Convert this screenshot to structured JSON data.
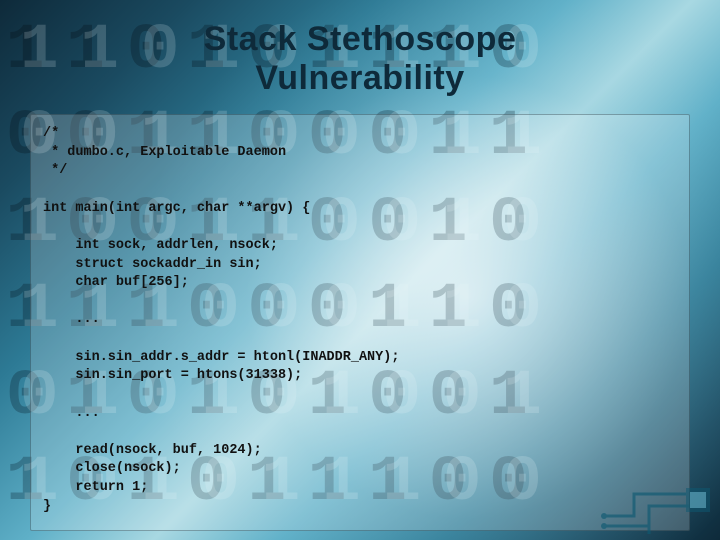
{
  "title_line1": "Stack Stethoscope",
  "title_line2": "Vulnerability",
  "code_lines": [
    "/*",
    " * dumbo.c, Exploitable Daemon",
    " */",
    "",
    "int main(int argc, char **argv) {",
    "",
    "    int sock, addrlen, nsock;",
    "    struct sockaddr_in sin;",
    "    char buf[256];",
    "",
    "    ...",
    "",
    "    sin.sin_addr.s_addr = htonl(INADDR_ANY);",
    "    sin.sin_port = htons(31338);",
    "",
    "    ...",
    "",
    "    read(nsock, buf, 1024);",
    "    close(nsock);",
    "    return 1;",
    "}"
  ],
  "bg_digits": "110101110\n001100011\n100110010\n111000110\n010101001\n101011100"
}
